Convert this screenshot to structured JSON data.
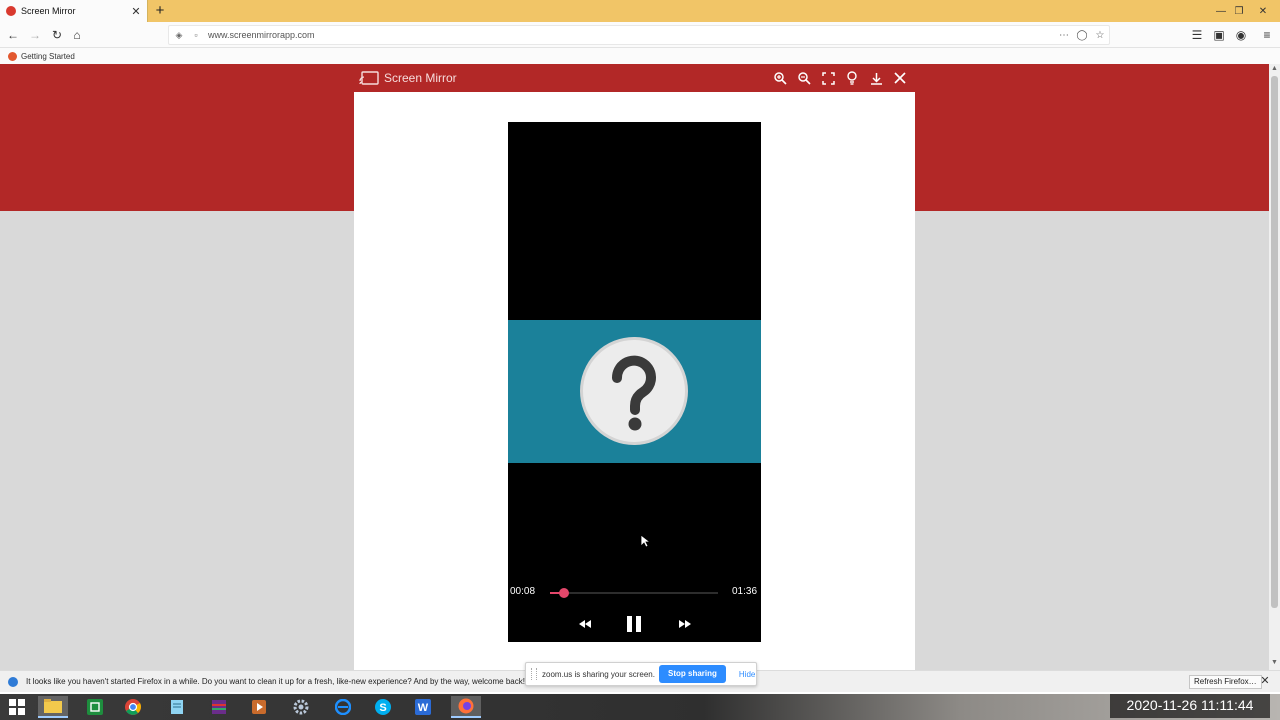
{
  "browser": {
    "tab_title": "Screen Mirror",
    "url": "www.screenmirrorapp.com",
    "bookmark": "Getting Started",
    "new_tab": "+",
    "close_tab": "✕"
  },
  "modal": {
    "title": "Screen Mirror",
    "tools": [
      "zoom-in-icon",
      "zoom-out-icon",
      "fullscreen-icon",
      "bulb-icon",
      "download-icon",
      "close-icon"
    ]
  },
  "player": {
    "current_time": "00:08",
    "duration": "01:36",
    "progress_fraction": 0.083,
    "colors": {
      "accent": "#e4476b",
      "band": "#1b819a"
    }
  },
  "notification": {
    "text": "It looks like you haven't started Firefox in a while. Do you want to clean it up for a fresh, like-new experience? And by the way, welcome back!",
    "refresh_label": "Refresh Firefox…",
    "close": "✕"
  },
  "zoom_share": {
    "message": "zoom.us is sharing your screen.",
    "stop_label": "Stop sharing",
    "hide_label": "Hide"
  },
  "taskbar": {
    "clock": "2020-11-26 11:11:44",
    "apps": [
      "start-icon",
      "file-explorer-icon",
      "sheets-icon",
      "chrome-icon",
      "notepad-icon",
      "winrar-icon",
      "media-player-icon",
      "settings-icon",
      "edge-icon",
      "skype-icon",
      "word-icon",
      "firefox-icon"
    ]
  },
  "colors": {
    "brand_red": "#b22827",
    "tab_strip": "#f1c567",
    "zoom_blue": "#2d8cff"
  }
}
